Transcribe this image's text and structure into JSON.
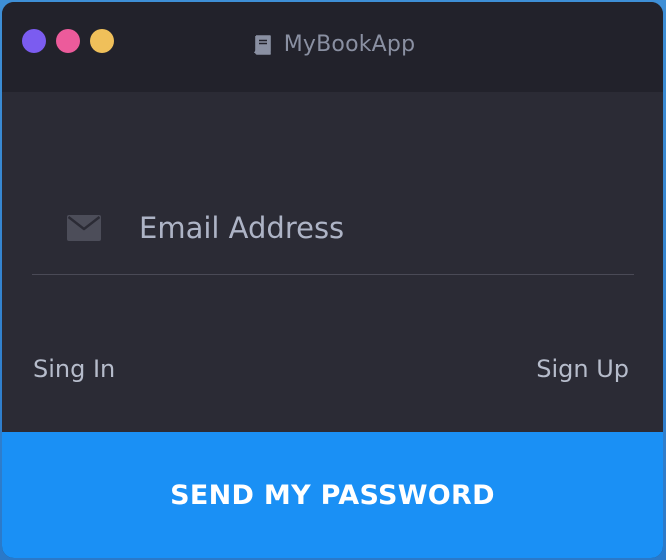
{
  "window": {
    "title": "MyBookApp",
    "traffic_lights": [
      {
        "name": "close",
        "color": "#7b5cf0"
      },
      {
        "name": "minimize",
        "color": "#ec5b9b"
      },
      {
        "name": "maximize",
        "color": "#f0c05a"
      }
    ],
    "title_icon": "book-icon"
  },
  "form": {
    "email_icon": "envelope-icon",
    "email_value": "",
    "email_placeholder": "Email Address"
  },
  "links": {
    "sign_in": "Sing In",
    "sign_up": "Sign Up"
  },
  "submit": {
    "label": "SEND MY PASSWORD"
  },
  "colors": {
    "background": "#2b2b35",
    "titlebar": "#22222b",
    "accent": "#1a90f5",
    "text_muted": "#b6bccb"
  }
}
